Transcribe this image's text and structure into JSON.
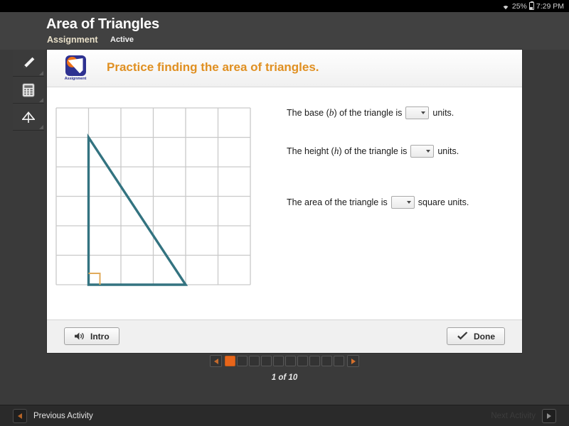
{
  "status_bar": {
    "wifi_icon": "wifi-icon",
    "battery_percent": "25%",
    "battery_icon": "battery-icon",
    "time": "7:29 PM"
  },
  "header": {
    "title": "Area of Triangles",
    "assignment_label": "Assignment",
    "state_label": "Active"
  },
  "tool_rail": {
    "items": [
      {
        "name": "marker-tool",
        "icon": "pencil-icon"
      },
      {
        "name": "calculator-tool",
        "icon": "calculator-icon"
      },
      {
        "name": "protractor-tool",
        "icon": "compass-icon"
      }
    ]
  },
  "card": {
    "logo_caption": "Assignment",
    "practice_title": "Practice finding the area of triangles.",
    "logo_colors": {
      "square": "#2e3191",
      "accent": "#ee7219"
    },
    "title_color": "#e09022"
  },
  "figure": {
    "name": "triangle-on-grid",
    "grid_cols": 6,
    "grid_rows": 6,
    "grid_color": "#c9c9c9",
    "triangle_color": "#337380",
    "right_angle_color": "#e0aa5a",
    "vertices": [
      {
        "col": 1,
        "row": 1
      },
      {
        "col": 1,
        "row": 6
      },
      {
        "col": 4,
        "row": 6
      }
    ],
    "base_units": 3,
    "height_units": 5
  },
  "questions": [
    {
      "name": "base-question",
      "prefix": "The base (",
      "variable": "b",
      "middle": ") of the triangle is",
      "suffix": "units.",
      "value": "",
      "select_name": "base-select"
    },
    {
      "name": "height-question",
      "prefix": "The height (",
      "variable": "h",
      "middle": ") of the triangle is",
      "suffix": "units.",
      "value": "",
      "select_name": "height-select"
    },
    {
      "name": "area-question",
      "prefix": "The area of the triangle is",
      "variable": "",
      "middle": "",
      "suffix": "square units.",
      "value": "",
      "select_name": "area-select"
    }
  ],
  "card_footer": {
    "intro_label": "Intro",
    "intro_icon": "speaker-icon",
    "done_label": "Done",
    "done_icon": "checkmark-icon"
  },
  "pagination": {
    "prev_icon": "chevron-left-icon",
    "next_icon": "chevron-right-icon",
    "total_pages": 10,
    "current_page": 1,
    "count_label": "1 of 10",
    "active_color": "#e8651a"
  },
  "activity_bar": {
    "previous_label": "Previous Activity",
    "previous_icon": "triangle-left-icon",
    "next_label": "Next Activity",
    "next_icon": "triangle-right-icon"
  }
}
